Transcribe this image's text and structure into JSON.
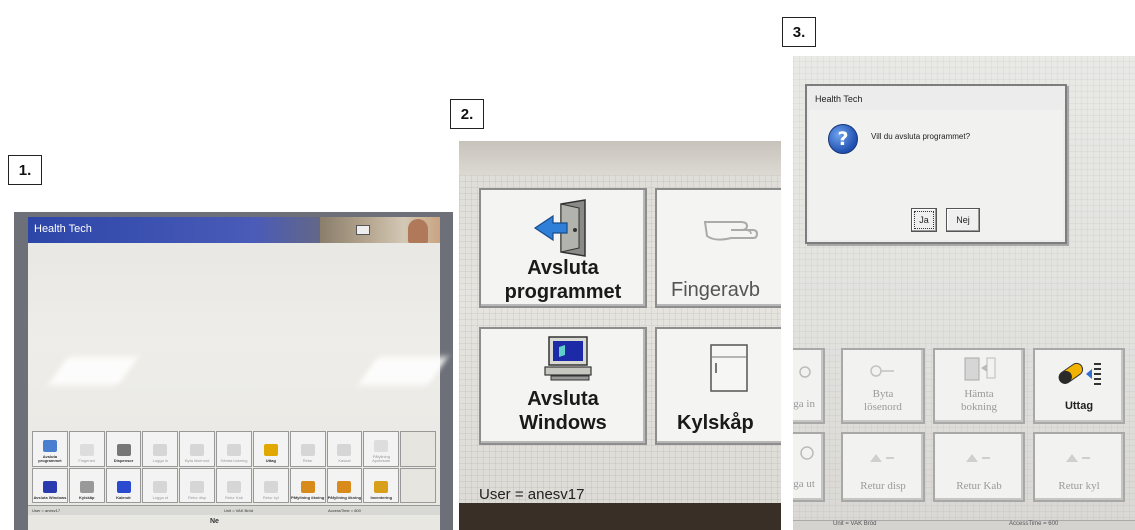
{
  "step_labels": [
    "1.",
    "2.",
    "3."
  ],
  "photo1": {
    "title": "Health Tech",
    "row1": [
      {
        "label": "Avsluta programmet",
        "state": "active",
        "icon": "exit-door-icon"
      },
      {
        "label": "Fingeravt",
        "state": "dim",
        "icon": "finger-icon"
      },
      {
        "label": "Dispensor",
        "state": "active",
        "icon": "cabinet-icon"
      },
      {
        "label": "Logga in",
        "state": "dim",
        "icon": "key-icon"
      },
      {
        "label": "Byta lösenord",
        "state": "dim",
        "icon": "key-icon"
      },
      {
        "label": "Hämta bokning",
        "state": "dim",
        "icon": "booking-icon"
      },
      {
        "label": "Uttag",
        "state": "active",
        "icon": "pill-out-icon"
      },
      {
        "label": "Retur",
        "state": "dim",
        "icon": "return-icon"
      },
      {
        "label": "Kassat",
        "state": "dim",
        "icon": "discard-icon"
      },
      {
        "label": "Påfyllning Apotekare",
        "state": "dim",
        "icon": "lightbulb-icon"
      },
      {
        "label": "",
        "state": "empty",
        "icon": ""
      }
    ],
    "row2": [
      {
        "label": "Avsluta Windows",
        "state": "active",
        "icon": "computer-icon"
      },
      {
        "label": "Kylskåp",
        "state": "active",
        "icon": "fridge-icon"
      },
      {
        "label": "Kalendr",
        "state": "active",
        "icon": "calendar-icon"
      },
      {
        "label": "Logga ut",
        "state": "dim",
        "icon": "logout-icon"
      },
      {
        "label": "Retur disp",
        "state": "dim",
        "icon": "return-icon"
      },
      {
        "label": "Retur Kab",
        "state": "dim",
        "icon": "return-icon"
      },
      {
        "label": "Retur kyl",
        "state": "dim",
        "icon": "return-icon"
      },
      {
        "label": "Påfyllning ökning",
        "state": "active",
        "icon": "refill-icon"
      },
      {
        "label": "Påfyllning ökning",
        "state": "active",
        "icon": "refill-icon"
      },
      {
        "label": "Inventering",
        "state": "active",
        "icon": "inventory-icon"
      },
      {
        "label": "",
        "state": "empty",
        "icon": ""
      }
    ],
    "brand": "Ne"
  },
  "photo2": {
    "buttons": [
      {
        "label_lines": [
          "Avsluta",
          "programmet"
        ],
        "icon": "exit-door-icon",
        "state": "active"
      },
      {
        "label_lines": [
          "Fingeravb"
        ],
        "icon": "finger-pointing-icon",
        "state": "dim"
      },
      {
        "label_lines": [
          "Avsluta",
          "Windows"
        ],
        "icon": "computer-icon",
        "state": "active"
      },
      {
        "label_lines": [
          "Kylskåp"
        ],
        "icon": "fridge-icon",
        "state": "active"
      }
    ],
    "status": "User = anesv17"
  },
  "photo3": {
    "dialog": {
      "title": "Health Tech",
      "message": "Vill du avsluta programmet?",
      "yes_label": "Ja",
      "no_label": "Nej",
      "icon": "question-icon"
    },
    "buttons_row1": [
      "ga in",
      "Byta lösenord",
      "Hämta bokning",
      "Uttag"
    ],
    "buttons_row2": [
      "ga ut",
      "Retur disp",
      "Retur Kab",
      "Retur kyl"
    ],
    "status": [
      "Unit = VAK Bröd",
      "AccessTime = 600"
    ]
  }
}
